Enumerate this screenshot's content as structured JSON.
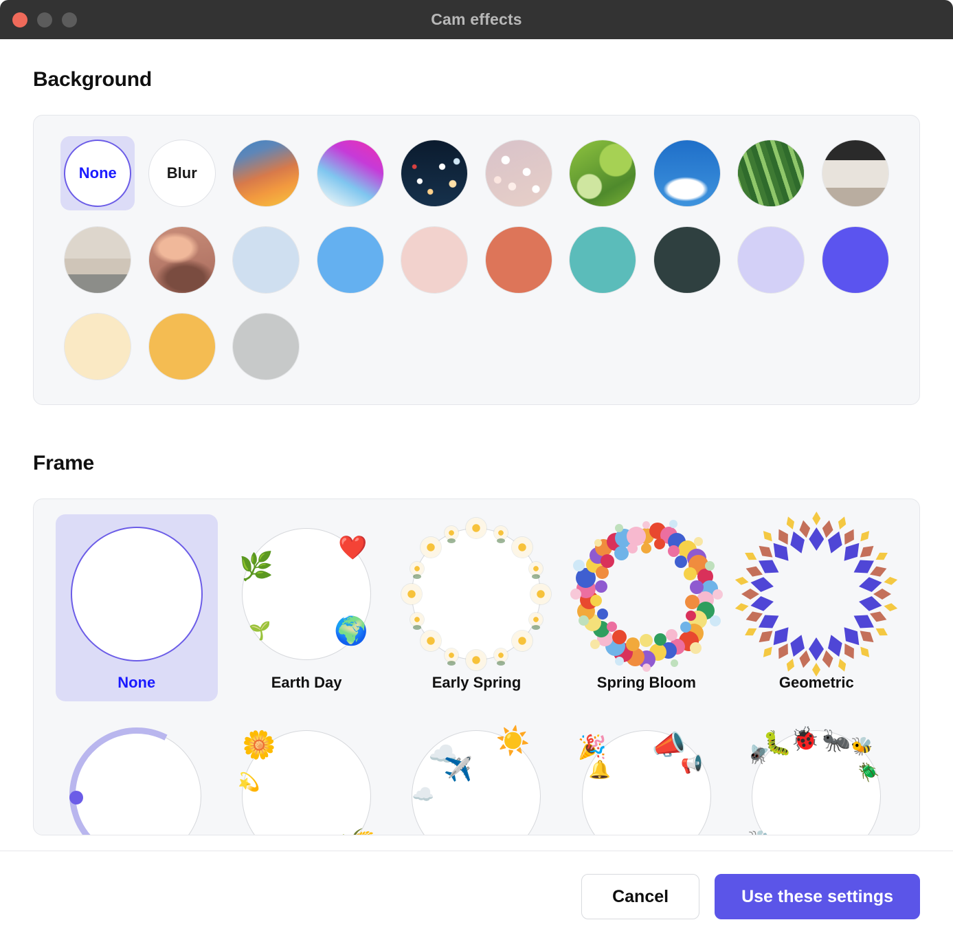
{
  "window": {
    "title": "Cam effects",
    "traffic_lights": [
      "close-button",
      "minimize-button",
      "maximize-button"
    ]
  },
  "background": {
    "heading": "Background",
    "selected": "None",
    "items": [
      {
        "id": "none",
        "label": "None",
        "kind": "label",
        "color": "#ffffff"
      },
      {
        "id": "blur",
        "label": "Blur",
        "kind": "label",
        "color": "#ffffff"
      },
      {
        "id": "gradient-warm",
        "label": "",
        "kind": "gradient",
        "color": "#f0a63c"
      },
      {
        "id": "gradient-pink",
        "label": "",
        "kind": "gradient",
        "color": "#e03fc0"
      },
      {
        "id": "bokeh-night",
        "label": "",
        "kind": "photo",
        "color": "#12243a"
      },
      {
        "id": "bokeh-rose",
        "label": "",
        "kind": "photo",
        "color": "#d9c4c0"
      },
      {
        "id": "green-leaves",
        "label": "",
        "kind": "photo",
        "color": "#7cb93f"
      },
      {
        "id": "blue-sky",
        "label": "",
        "kind": "photo",
        "color": "#2b7fd4"
      },
      {
        "id": "palm-leaf",
        "label": "",
        "kind": "photo",
        "color": "#3d7a38"
      },
      {
        "id": "cafe-room",
        "label": "",
        "kind": "photo",
        "color": "#b6a99b"
      },
      {
        "id": "living-room",
        "label": "",
        "kind": "photo",
        "color": "#cfc7bd"
      },
      {
        "id": "sunset-clouds",
        "label": "",
        "kind": "photo",
        "color": "#c58a76"
      },
      {
        "id": "solid-pale-blue",
        "label": "",
        "kind": "solid",
        "color": "#cfdff0"
      },
      {
        "id": "solid-sky-blue",
        "label": "",
        "kind": "solid",
        "color": "#64b0f0"
      },
      {
        "id": "solid-blush",
        "label": "",
        "kind": "solid",
        "color": "#f2d2cd"
      },
      {
        "id": "solid-coral",
        "label": "",
        "kind": "solid",
        "color": "#dd7559"
      },
      {
        "id": "solid-teal",
        "label": "",
        "kind": "solid",
        "color": "#5bbcba"
      },
      {
        "id": "solid-dark-slate",
        "label": "",
        "kind": "solid",
        "color": "#2f4040"
      },
      {
        "id": "solid-lavender",
        "label": "",
        "kind": "solid",
        "color": "#d3d0f7"
      },
      {
        "id": "solid-indigo",
        "label": "",
        "kind": "solid",
        "color": "#5b54ef"
      },
      {
        "id": "solid-cream",
        "label": "",
        "kind": "solid",
        "color": "#fae9c4"
      },
      {
        "id": "solid-amber",
        "label": "",
        "kind": "solid",
        "color": "#f4bc52"
      },
      {
        "id": "solid-gray",
        "label": "",
        "kind": "solid",
        "color": "#c7c9c9"
      }
    ]
  },
  "frame": {
    "heading": "Frame",
    "selected": "None",
    "items": [
      {
        "id": "none",
        "label": "None",
        "theme": "none"
      },
      {
        "id": "earth-day",
        "label": "Earth Day",
        "theme": "earth"
      },
      {
        "id": "early-spring",
        "label": "Early Spring",
        "theme": "daffodil"
      },
      {
        "id": "spring-bloom",
        "label": "Spring Bloom",
        "theme": "floral-wreath"
      },
      {
        "id": "geometric",
        "label": "Geometric",
        "theme": "diamonds"
      }
    ],
    "items_row2": [
      {
        "id": "arc-purple",
        "label": "",
        "theme": "arc"
      },
      {
        "id": "flower-petal",
        "label": "",
        "theme": "petal"
      },
      {
        "id": "weather",
        "label": "",
        "theme": "weather"
      },
      {
        "id": "celebration",
        "label": "",
        "theme": "party"
      },
      {
        "id": "bugs",
        "label": "",
        "theme": "bugs"
      }
    ]
  },
  "footer": {
    "cancel_label": "Cancel",
    "confirm_label": "Use these settings",
    "accent_color": "#5b55e8"
  }
}
